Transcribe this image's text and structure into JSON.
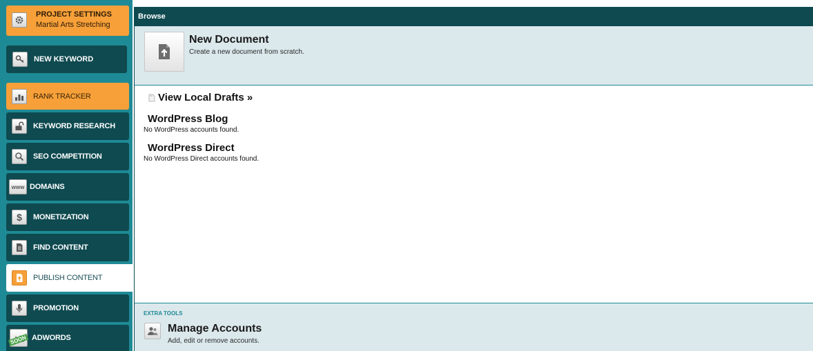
{
  "sidebar": {
    "project": {
      "title": "PROJECT SETTINGS",
      "subtitle": "Martial Arts Stretching"
    },
    "new_keyword": "NEW KEYWORD",
    "items": [
      {
        "label": "RANK TRACKER",
        "icon": "bar-chart-icon",
        "state": "highlighted"
      },
      {
        "label": "KEYWORD RESEARCH",
        "icon": "lock-icon",
        "state": "normal"
      },
      {
        "label": "SEO COMPETITION",
        "icon": "magnifier-icon",
        "state": "normal"
      },
      {
        "label": "DOMAINS",
        "icon": "www-icon",
        "state": "normal"
      },
      {
        "label": "MONETIZATION",
        "icon": "dollar-icon",
        "state": "normal"
      },
      {
        "label": "FIND CONTENT",
        "icon": "document-icon",
        "state": "normal"
      },
      {
        "label": "PUBLISH CONTENT",
        "icon": "publish-icon",
        "state": "active"
      },
      {
        "label": "PROMOTION",
        "icon": "microphone-icon",
        "state": "normal"
      },
      {
        "label": "ADWORDS",
        "icon": "adwords-icon",
        "state": "normal",
        "badge": "SOON"
      }
    ]
  },
  "main": {
    "header": "Browse",
    "new_document": {
      "title": "New Document",
      "description": "Create a new document from scratch."
    },
    "drafts_link": "View Local Drafts »",
    "sections": [
      {
        "title": "WordPress Blog",
        "message": "No WordPress accounts found."
      },
      {
        "title": "WordPress Direct",
        "message": "No WordPress Direct accounts found."
      }
    ],
    "extra_tools": {
      "heading": "EXTRA TOOLS",
      "title": "Manage Accounts",
      "description": "Add, edit or remove accounts."
    }
  },
  "colors": {
    "teal_dark": "#0e4a50",
    "teal_sidebar": "#1e8a95",
    "orange": "#f7a039",
    "panel_blue": "#dbe8ec"
  }
}
